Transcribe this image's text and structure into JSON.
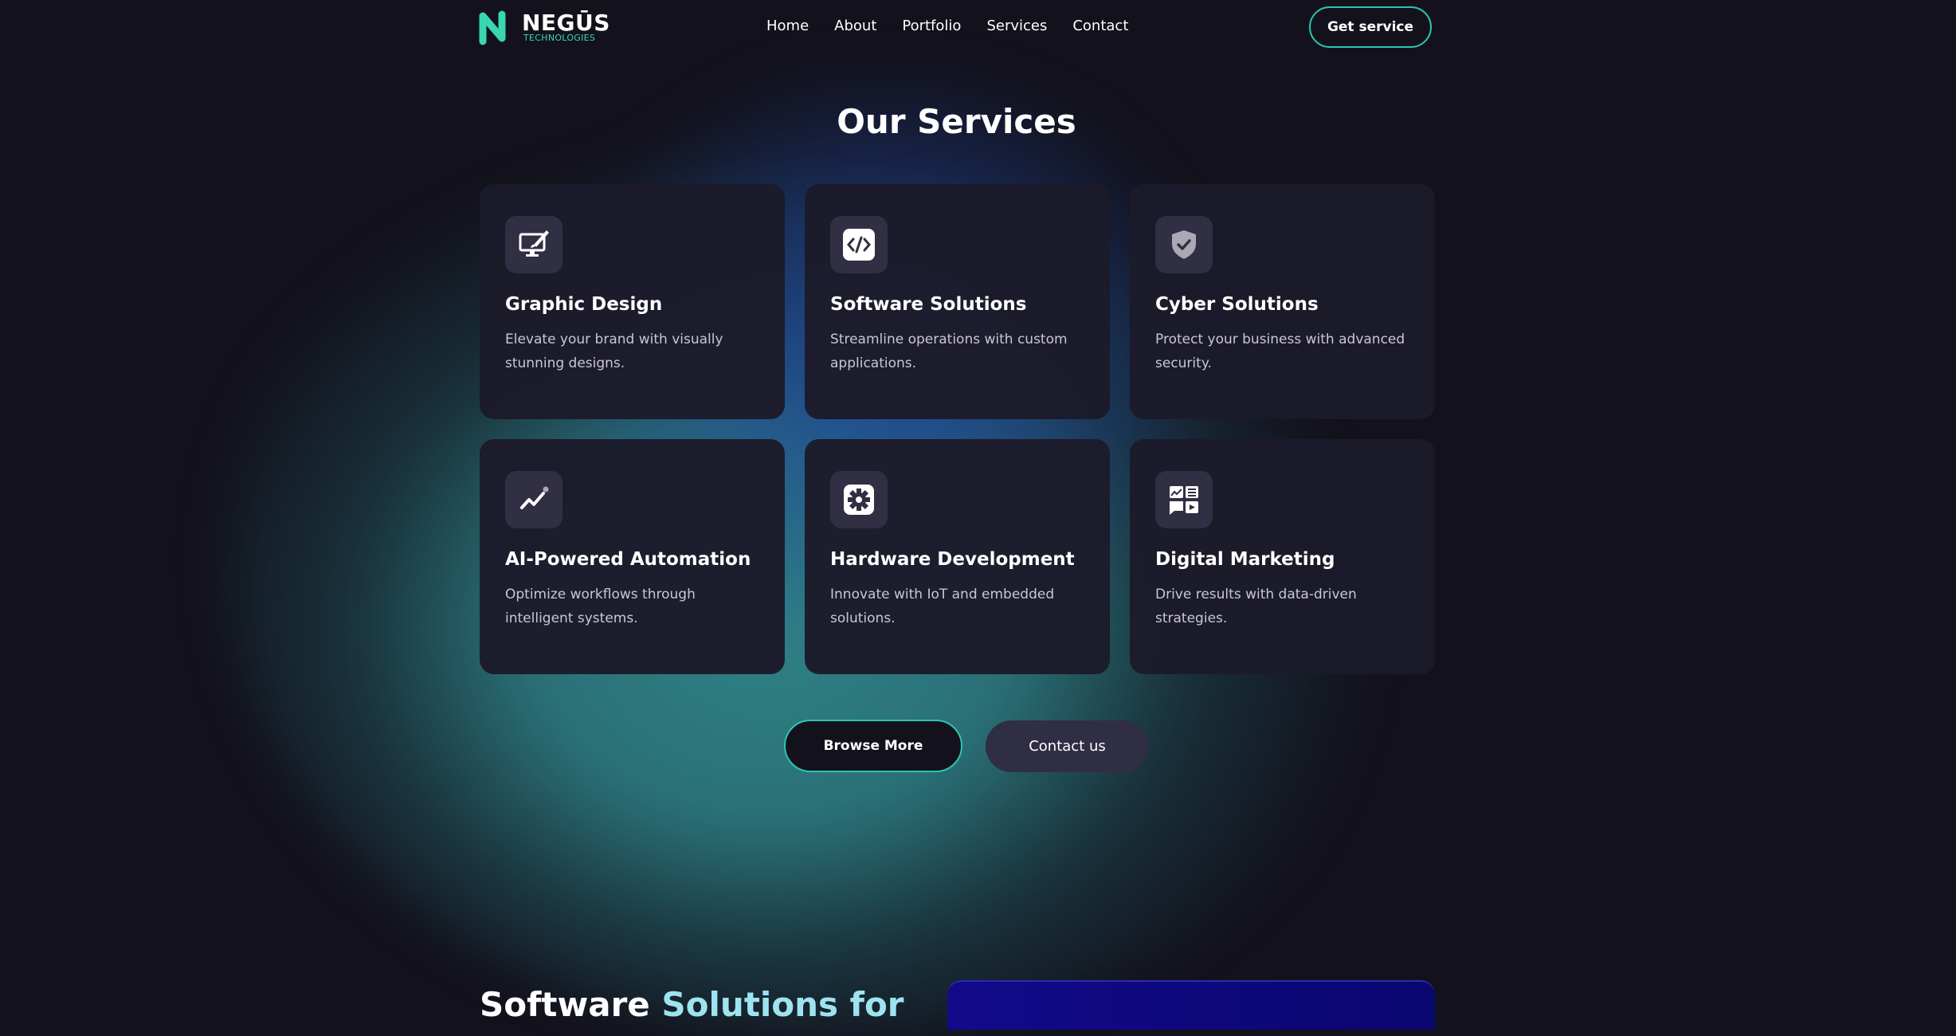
{
  "header": {
    "logo_name": "NEGŪS",
    "logo_sub": "TECHNOLOGIES",
    "nav": [
      {
        "label": "Home"
      },
      {
        "label": "About"
      },
      {
        "label": "Portfolio"
      },
      {
        "label": "Services"
      },
      {
        "label": "Contact"
      }
    ],
    "cta_label": "Get service"
  },
  "services": {
    "title": "Our Services",
    "cards": [
      {
        "icon": "graphic-design-icon",
        "title": "Graphic Design",
        "desc": "Elevate your brand with visually stunning designs."
      },
      {
        "icon": "code-icon",
        "title": "Software Solutions",
        "desc": "Streamline operations with custom applications."
      },
      {
        "icon": "shield-check-icon",
        "title": "Cyber Solutions",
        "desc": "Protect your business with advanced security."
      },
      {
        "icon": "trend-line-icon",
        "title": "AI-Powered Automation",
        "desc": "Optimize workflows through intelligent systems."
      },
      {
        "icon": "gear-icon",
        "title": "Hardware Development",
        "desc": "Innovate with IoT and embedded solutions."
      },
      {
        "icon": "marketing-dashboard-icon",
        "title": "Digital Marketing",
        "desc": "Drive results with data-driven strategies."
      }
    ],
    "browse_label": "Browse More",
    "contact_label": "Contact us"
  },
  "next_section": {
    "heading_part1": "Software ",
    "heading_part2": "Solutions for"
  },
  "colors": {
    "background": "#13121c",
    "accent": "#2cc5b4",
    "card": "#1c1b2a",
    "logo_green": "#39d6b0"
  }
}
